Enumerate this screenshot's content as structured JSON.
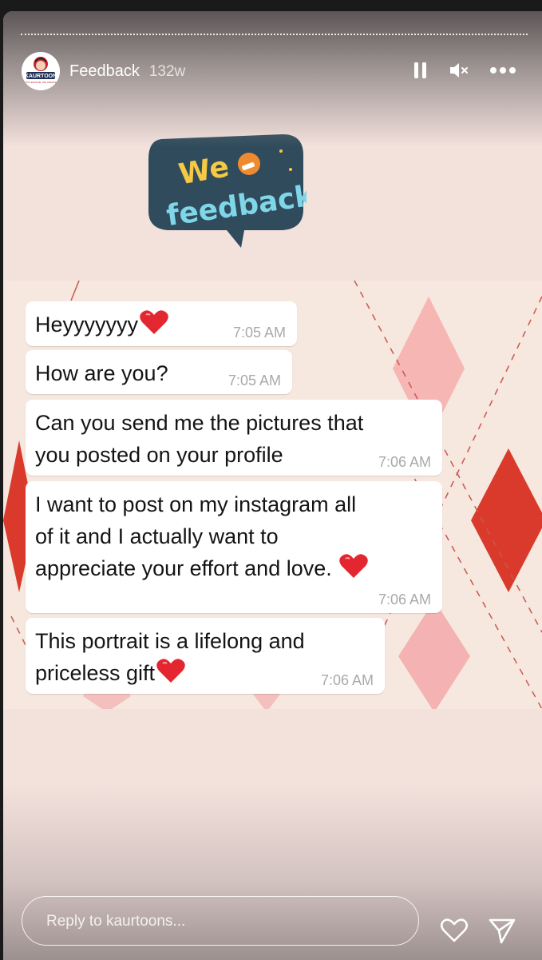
{
  "header": {
    "account_name": "Feedback",
    "age": "132w",
    "avatar_label": "KAURTOON",
    "avatar_tagline": "YOU IMAGINE, WE CREATE"
  },
  "sticker": {
    "line1": "We",
    "line2": "feedback"
  },
  "messages": [
    {
      "text": "Heyyyyyyy",
      "time": "7:05 AM",
      "heart": true
    },
    {
      "text": "How are you?",
      "time": "7:05 AM",
      "heart": false
    },
    {
      "text_lines": [
        "Can you send me the pictures that",
        "you posted on your profile"
      ],
      "time": "7:06 AM"
    },
    {
      "text_lines": [
        "I want to post on my instagram all",
        "of it and I actually want to",
        "appreciate your effort and love."
      ],
      "time": "7:06 AM",
      "heart": true
    },
    {
      "text_lines": [
        "This portrait is a lifelong and",
        "priceless gift"
      ],
      "time": "7:06 AM",
      "heart": true
    }
  ],
  "footer": {
    "reply_placeholder": "Reply to kaurtoons..."
  },
  "colors": {
    "heart": "#e3262f",
    "sticker_bg": "#2f4b5c",
    "sticker_text": "#f6c945",
    "sticker_text2": "#7fd6e8",
    "diamond_red": "#d93a2b",
    "diamond_pink": "#f4a6a6"
  }
}
